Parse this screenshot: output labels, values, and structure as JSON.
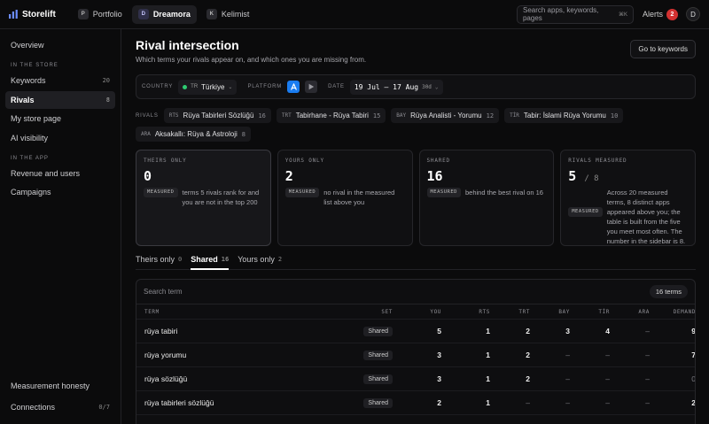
{
  "app": {
    "name": "Storelift"
  },
  "apps": [
    {
      "letter": "P",
      "name": "Portfolio",
      "active": false
    },
    {
      "letter": "D",
      "name": "Dreamora",
      "active": true
    },
    {
      "letter": "K",
      "name": "Kelimist",
      "active": false
    }
  ],
  "search": {
    "placeholder": "Search apps, keywords, pages",
    "shortcut": "⌘K"
  },
  "alerts": {
    "label": "Alerts",
    "count": "2"
  },
  "user": {
    "initial": "D"
  },
  "sidebar": {
    "overview": "Overview",
    "section_store": "IN THE STORE",
    "store_items": [
      {
        "label": "Keywords",
        "count": "20"
      },
      {
        "label": "Rivals",
        "count": "8"
      },
      {
        "label": "My store page",
        "count": ""
      },
      {
        "label": "AI visibility",
        "count": ""
      }
    ],
    "section_app": "IN THE APP",
    "app_items": [
      {
        "label": "Revenue and users"
      },
      {
        "label": "Campaigns"
      }
    ],
    "bottom": [
      {
        "label": "Measurement honesty",
        "count": ""
      },
      {
        "label": "Connections",
        "count": "0/7"
      }
    ]
  },
  "page": {
    "title": "Rival intersection",
    "subtitle": "Which terms your rivals appear on, and which ones you are missing from.",
    "goto_label": "Go to keywords"
  },
  "filters": {
    "country_label": "COUNTRY",
    "country_code": "TR",
    "country_name": "Türkiye",
    "platform_label": "PLATFORM",
    "date_label": "DATE",
    "date_range": "19 Jul – 17 Aug",
    "date_span": "30d"
  },
  "rivals": {
    "label": "RIVALS",
    "items": [
      {
        "code": "RTS",
        "name": "Rüya Tabirleri Sözlüğü",
        "count": "16"
      },
      {
        "code": "TRT",
        "name": "Tabirhane - Rüya Tabiri",
        "count": "15"
      },
      {
        "code": "BAY",
        "name": "Rüya Analisti - Yorumu",
        "count": "12"
      },
      {
        "code": "TİR",
        "name": "Tabir: İslami Rüya Yorumu",
        "count": "10"
      },
      {
        "code": "ARA",
        "name": "Aksakallı: Rüya & Astroloji",
        "count": "8"
      }
    ]
  },
  "cards": [
    {
      "label": "THEIRS ONLY",
      "value": "0",
      "of": "",
      "tag": "MEASURED",
      "desc": "terms 5 rivals rank for and you are not in the top 200",
      "selected": true
    },
    {
      "label": "YOURS ONLY",
      "value": "2",
      "of": "",
      "tag": "MEASURED",
      "desc": "no rival in the measured list above you",
      "selected": false
    },
    {
      "label": "SHARED",
      "value": "16",
      "of": "",
      "tag": "MEASURED",
      "desc": "behind the best rival on 16",
      "selected": false
    },
    {
      "label": "RIVALS MEASURED",
      "value": "5",
      "of": "/ 8",
      "tag": "MEASURED",
      "desc": "Across 20 measured terms, 8 distinct apps appeared above you; the table is built from the five you meet most often. The number in the sidebar is 8.",
      "selected": false
    }
  ],
  "tabs": [
    {
      "label": "Theirs only",
      "count": "0",
      "active": false
    },
    {
      "label": "Shared",
      "count": "16",
      "active": true
    },
    {
      "label": "Yours only",
      "count": "2",
      "active": false
    }
  ],
  "table": {
    "search_placeholder": "Search term",
    "term_count": "16 terms",
    "columns": [
      "TERM",
      "SET",
      "YOU",
      "RTS",
      "TRT",
      "BAY",
      "TİR",
      "ARA",
      "DEMAND"
    ],
    "rows": [
      {
        "term": "rüya tabiri",
        "set": "Shared",
        "you": "5",
        "rts": "1",
        "trt": "2",
        "bay": "3",
        "tir": "4",
        "ara": "–",
        "demand": "9"
      },
      {
        "term": "rüya yorumu",
        "set": "Shared",
        "you": "3",
        "rts": "1",
        "trt": "2",
        "bay": "–",
        "tir": "–",
        "ara": "–",
        "demand": "7"
      },
      {
        "term": "rüya sözlüğü",
        "set": "Shared",
        "you": "3",
        "rts": "1",
        "trt": "2",
        "bay": "–",
        "tir": "–",
        "ara": "–",
        "demand": "0"
      },
      {
        "term": "rüya tabirleri sözlüğü",
        "set": "Shared",
        "you": "2",
        "rts": "1",
        "trt": "–",
        "bay": "–",
        "tir": "–",
        "ara": "–",
        "demand": "2"
      }
    ]
  }
}
